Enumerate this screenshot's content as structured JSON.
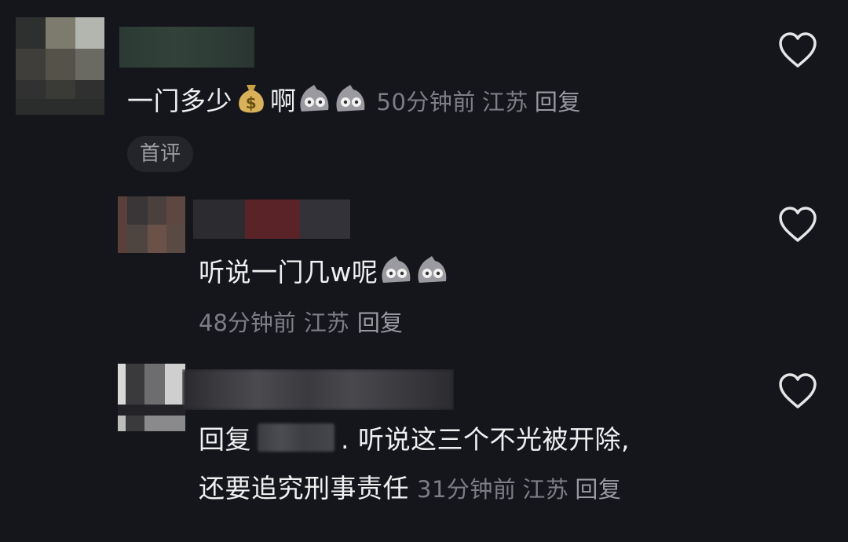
{
  "comments": [
    {
      "text": "一门多少",
      "text_after_money": "啊",
      "time": "50分钟前",
      "location": "江苏",
      "reply_label": "回复",
      "badge": "首评",
      "liked": false
    },
    {
      "text": "听说一门几w呢",
      "time": "48分钟前",
      "location": "江苏",
      "reply_label": "回复",
      "liked": false
    },
    {
      "reply_prefix": "回复",
      "text_line1": ". 听说这三个不光被开除,",
      "text_line2": "还要追究刑事责任",
      "time": "31分钟前",
      "location": "江苏",
      "reply_label": "回复",
      "liked": false
    }
  ],
  "icons": {
    "heart": "heart-outline-icon",
    "money": "money-bag-emoji",
    "dog": "doge-emoji"
  },
  "colors": {
    "background": "#15161b",
    "text": "#f0f0f2",
    "meta": "#7d7e85",
    "badge_bg": "#24252b"
  }
}
